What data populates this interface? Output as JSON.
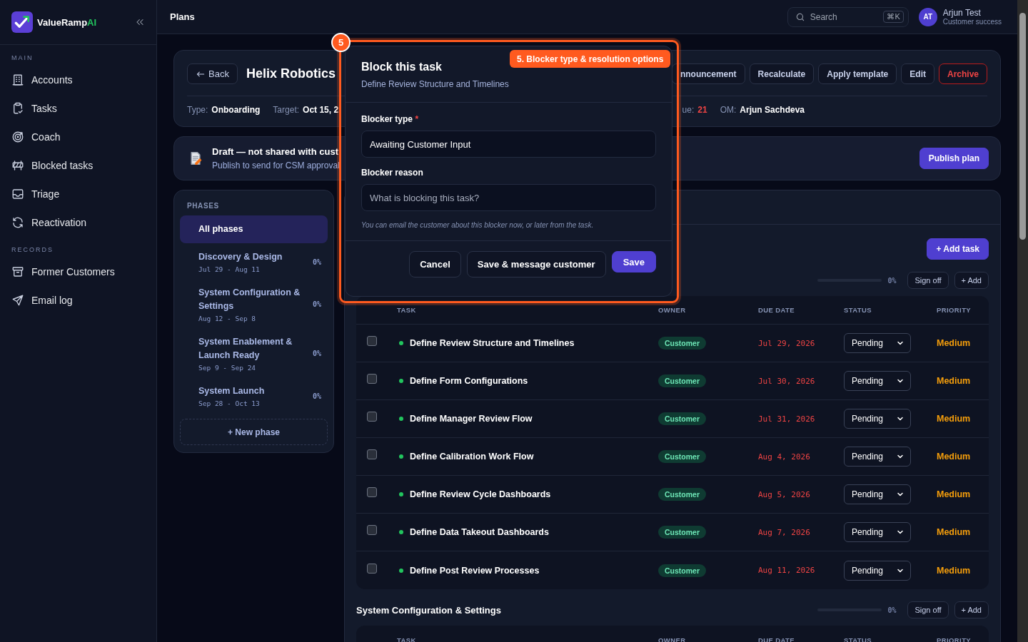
{
  "sidebar": {
    "brand": {
      "name": "ValueRamp",
      "accent": "AI"
    },
    "sections": [
      {
        "title": "MAIN",
        "items": [
          {
            "label": "Accounts",
            "selected": false
          },
          {
            "label": "Tasks",
            "selected": false
          },
          {
            "label": "Coach",
            "selected": false
          },
          {
            "label": "Blocked tasks",
            "selected": false
          },
          {
            "label": "Triage",
            "selected": false
          },
          {
            "label": "Reactivation",
            "selected": false
          }
        ]
      },
      {
        "title": "RECORDS",
        "items": [
          {
            "label": "Former Customers",
            "selected": false
          },
          {
            "label": "Email log",
            "selected": false
          }
        ]
      }
    ]
  },
  "topbar": {
    "title": "Plans",
    "search": {
      "placeholder": "Search",
      "shortcut": "⌘K"
    },
    "user": {
      "initials": "AT",
      "name": "Arjun Test",
      "role": "Customer success"
    }
  },
  "plan_header": {
    "back": "Back",
    "title": "Helix Robotics",
    "actions": [
      {
        "label": "nnouncement",
        "kind": "outline"
      },
      {
        "label": "Recalculate",
        "kind": "outline"
      },
      {
        "label": "Apply template",
        "kind": "outline"
      },
      {
        "label": "Edit",
        "kind": "outline"
      },
      {
        "label": "Archive",
        "kind": "danger"
      }
    ],
    "meta_left": [
      {
        "label": "Type:",
        "value": "Onboarding",
        "alert": false
      },
      {
        "label": "Target:",
        "value": "Oct 15, 2",
        "alert": false
      }
    ],
    "meta_right": [
      {
        "label": "ue:",
        "value": "21",
        "alert": true
      },
      {
        "label": "OM:",
        "value": "Arjun Sachdeva",
        "alert": false
      }
    ]
  },
  "draft_banner": {
    "title": "Draft — not shared with cust",
    "subtitle": "Publish to send for CSM approval",
    "action": "Publish plan"
  },
  "phases": {
    "title": "PHASES",
    "new_phase": "+ New phase",
    "items": [
      {
        "name": "All phases",
        "selected": true
      },
      {
        "name": "Discovery & Design",
        "dates": "Jul 29 - Aug 11",
        "progress": "0%",
        "selected": false
      },
      {
        "name": "System Configuration & Settings",
        "dates": "Aug 12 - Sep 8",
        "progress": "0%",
        "selected": false
      },
      {
        "name": "System Enablement & Launch Ready",
        "dates": "Sep 9 - Sep 24",
        "progress": "0%",
        "selected": false
      },
      {
        "name": "System Launch",
        "dates": "Sep 28 - Oct 13",
        "progress": "0%",
        "selected": false
      }
    ]
  },
  "tasks": {
    "add_task": "+ Add task",
    "sections": [
      {
        "progress": "0%",
        "level": 0,
        "actions": [
          "Sign off",
          "+ Add"
        ],
        "columns": [
          "TASK",
          "OWNER",
          "DUE DATE",
          "STATUS",
          "PRIORITY"
        ],
        "rows": [
          {
            "checked": false,
            "color": "#22c55e",
            "task": "Define Review Structure and Timelines",
            "owner": "Customer",
            "due": "Jul 29, 2026",
            "overdue": true,
            "status": "Pending",
            "priority": "Medium"
          },
          {
            "checked": false,
            "color": "#22c55e",
            "task": "Define Form Configurations",
            "owner": "Customer",
            "due": "Jul 30, 2026",
            "overdue": true,
            "status": "Pending",
            "priority": "Medium"
          },
          {
            "checked": false,
            "color": "#22c55e",
            "task": "Define Manager Review Flow",
            "owner": "Customer",
            "due": "Jul 31, 2026",
            "overdue": true,
            "status": "Pending",
            "priority": "Medium"
          },
          {
            "checked": false,
            "color": "#22c55e",
            "task": "Define Calibration Work Flow",
            "owner": "Customer",
            "due": "Aug 4, 2026",
            "overdue": true,
            "status": "Pending",
            "priority": "Medium"
          },
          {
            "checked": false,
            "color": "#22c55e",
            "task": "Define Review Cycle Dashboards",
            "owner": "Customer",
            "due": "Aug 5, 2026",
            "overdue": true,
            "status": "Pending",
            "priority": "Medium"
          },
          {
            "checked": false,
            "color": "#22c55e",
            "task": "Define Data Takeout Dashboards",
            "owner": "Customer",
            "due": "Aug 7, 2026",
            "overdue": true,
            "status": "Pending",
            "priority": "Medium"
          },
          {
            "checked": false,
            "color": "#22c55e",
            "task": "Define Post Review Processes",
            "owner": "Customer",
            "due": "Aug 11, 2026",
            "overdue": true,
            "status": "Pending",
            "priority": "Medium"
          }
        ]
      },
      {
        "title": "System Configuration & Settings",
        "progress": "0%",
        "level": 0,
        "actions": [
          "Sign off",
          "+ Add"
        ],
        "columns": [
          "TASK",
          "OWNER",
          "DUE DATE",
          "STATUS",
          "PRIORITY"
        ]
      }
    ]
  },
  "modal": {
    "step": "5",
    "callout": "5. Blocker type & resolution options",
    "title": "Block this task",
    "subtitle": "Define Review Structure and Timelines",
    "fields": [
      {
        "label": "Blocker type",
        "required_mark": "*",
        "value": "Awaiting Customer Input"
      },
      {
        "label": "Blocker reason",
        "placeholder": "What is blocking this task?"
      }
    ],
    "hint": "You can email the customer about this blocker now, or later from the task.",
    "buttons": [
      {
        "label": "Cancel",
        "kind": "secondary"
      },
      {
        "label": "Save & message customer",
        "kind": "secondary"
      },
      {
        "label": "Save",
        "kind": "primary"
      }
    ]
  }
}
